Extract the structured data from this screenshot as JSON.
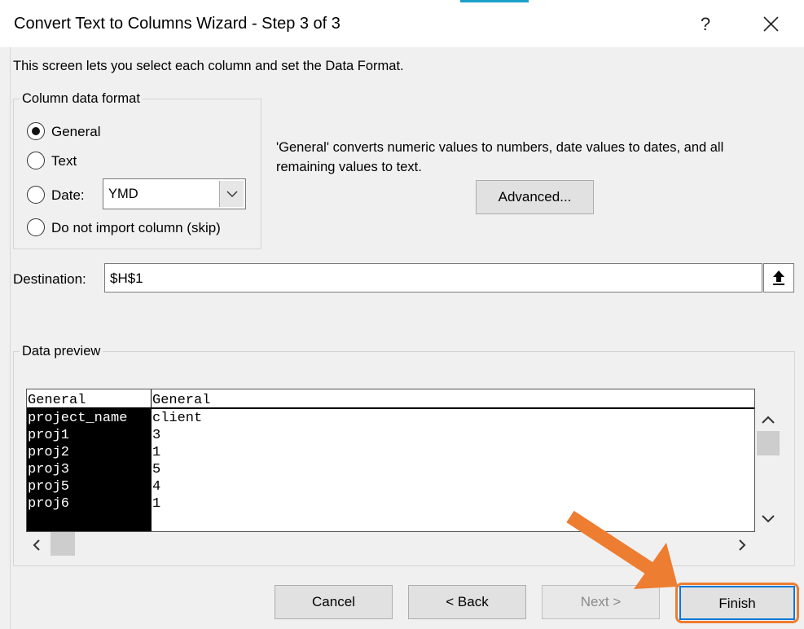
{
  "window": {
    "title": "Convert Text to Columns Wizard - Step 3 of 3",
    "help_label": "?",
    "close_icon": "close-icon"
  },
  "description": "This screen lets you select each column and set the Data Format.",
  "column_format": {
    "label": "Column data format",
    "options": [
      {
        "label": "General",
        "selected": true
      },
      {
        "label": "Text",
        "selected": false
      },
      {
        "label": "Date:",
        "selected": false
      },
      {
        "label": "Do not import column (skip)",
        "selected": false
      }
    ],
    "date_select_value": "YMD"
  },
  "info_text": "'General' converts numeric values to numbers, date values to dates, and all remaining values to text.",
  "advanced_button": "Advanced...",
  "destination": {
    "label": "Destination:",
    "value": "$H$1"
  },
  "data_preview": {
    "label": "Data preview",
    "headers": [
      "General",
      "General"
    ],
    "column1": [
      "project_name",
      "proj1",
      "proj2",
      "proj3",
      "proj5",
      "proj6"
    ],
    "column2": [
      "client",
      "3",
      "1",
      "5",
      "4",
      "1"
    ]
  },
  "buttons": {
    "cancel": "Cancel",
    "back": "< Back",
    "next": "Next >",
    "finish": "Finish"
  },
  "annotation": {
    "arrow_color": "#ed7d31"
  },
  "colors": {
    "accent": "#1ba1c8",
    "highlight": "#ed7d31",
    "dialog_bg": "#f0f0f0"
  }
}
